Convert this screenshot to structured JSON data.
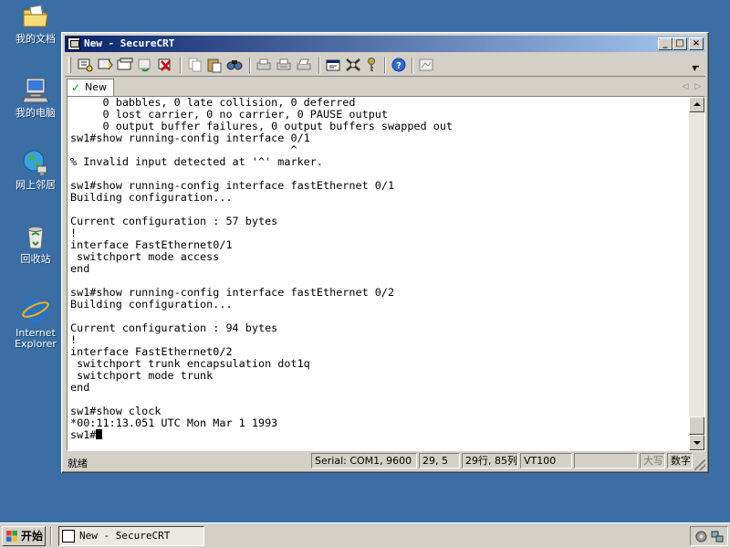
{
  "desktop": {
    "icons": [
      {
        "label": "我的文档"
      },
      {
        "label": "我的电脑"
      },
      {
        "label": "网上邻居"
      },
      {
        "label": "回收站"
      },
      {
        "label": "Internet\nExplorer"
      }
    ]
  },
  "window": {
    "title": "New - SecureCRT",
    "controls": {
      "minimize": "_",
      "maximize": "□",
      "close": "×"
    },
    "tab": {
      "label": "New"
    },
    "terminal_lines": [
      "     0 babbles, 0 late collision, 0 deferred",
      "     0 lost carrier, 0 no carrier, 0 PAUSE output",
      "     0 output buffer failures, 0 output buffers swapped out",
      "sw1#show running-config interface 0/1",
      "                                  ^",
      "% Invalid input detected at '^' marker.",
      "",
      "sw1#show running-config interface fastEthernet 0/1",
      "Building configuration...",
      "",
      "Current configuration : 57 bytes",
      "!",
      "interface FastEthernet0/1",
      " switchport mode access",
      "end",
      "",
      "sw1#show running-config interface fastEthernet 0/2",
      "Building configuration...",
      "",
      "Current configuration : 94 bytes",
      "!",
      "interface FastEthernet0/2",
      " switchport trunk encapsulation dot1q",
      " switchport mode trunk",
      "end",
      "",
      "sw1#show clock",
      "*00:11:13.051 UTC Mon Mar 1 1993"
    ],
    "prompt": "sw1#",
    "status": {
      "ready": "就绪",
      "connection": "Serial: COM1, 9600",
      "cursor_pos": "29,  5",
      "size": "29行, 85列",
      "emulation": "VT100",
      "blank": "",
      "caps": "大写",
      "num": "数字"
    }
  },
  "taskbar": {
    "start_label": "开始",
    "task_label": "New - SecureCRT"
  },
  "icons": {
    "toolbar": [
      "connect-icon",
      "quick-connect-icon",
      "connect-tab-icon",
      "reconnect-icon",
      "disconnect-icon",
      "copy-icon",
      "paste-icon",
      "find-icon",
      "print-icon",
      "print-selection-icon",
      "printer-setup-icon",
      "session-options-icon",
      "global-options-icon",
      "key-icon",
      "help-icon",
      "map-keys-icon"
    ]
  },
  "colors": {
    "desktop": "#3a6ea5",
    "title_start": "#0a246a",
    "title_end": "#a6caf0",
    "tab_check": "#1a8a1a"
  }
}
